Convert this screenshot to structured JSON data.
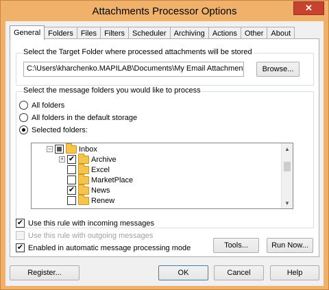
{
  "window": {
    "title": "Attachments Processor Options",
    "close_glyph": "✕"
  },
  "tabs": [
    {
      "label": "General",
      "active": true
    },
    {
      "label": "Folders"
    },
    {
      "label": "Files"
    },
    {
      "label": "Filters"
    },
    {
      "label": "Scheduler"
    },
    {
      "label": "Archiving"
    },
    {
      "label": "Actions"
    },
    {
      "label": "Other"
    },
    {
      "label": "About"
    }
  ],
  "target_folder": {
    "group_label": "Select the Target Folder where processed attachments will be stored",
    "path": "C:\\Users\\kharchenko.MAPILAB\\Documents\\My Email Attachments",
    "browse_label": "Browse..."
  },
  "message_folders": {
    "group_label": "Select the message folders you would like to process",
    "radios": [
      {
        "label": "All folders",
        "selected": false
      },
      {
        "label": "All folders in the default storage",
        "selected": false
      },
      {
        "label": "Selected folders:",
        "selected": true
      }
    ],
    "tree": [
      {
        "label": "Inbox",
        "checked": "partial",
        "expander": "−"
      },
      {
        "label": "Archive",
        "checked": "checked",
        "expander": "+"
      },
      {
        "label": "Excel",
        "checked": "unchecked"
      },
      {
        "label": "MarketPlace",
        "checked": "unchecked"
      },
      {
        "label": "News",
        "checked": "checked"
      },
      {
        "label": "Renew",
        "checked": "unchecked"
      }
    ]
  },
  "options": {
    "incoming": {
      "label": "Use this rule with incoming messages",
      "checked": true,
      "glyph": "✔"
    },
    "outgoing": {
      "label": "Use this rule with outgoing messages",
      "checked": false,
      "disabled": true
    },
    "automatic": {
      "label": "Enabled in automatic message processing mode",
      "checked": true,
      "glyph": "✔"
    },
    "tools_label": "Tools...",
    "run_now_label": "Run Now..."
  },
  "footer": {
    "register_label": "Register...",
    "ok_label": "OK",
    "cancel_label": "Cancel",
    "help_label": "Help"
  },
  "colors": {
    "frame": "#f0b26a",
    "close": "#c7432f",
    "folder": "#f4c44d"
  }
}
